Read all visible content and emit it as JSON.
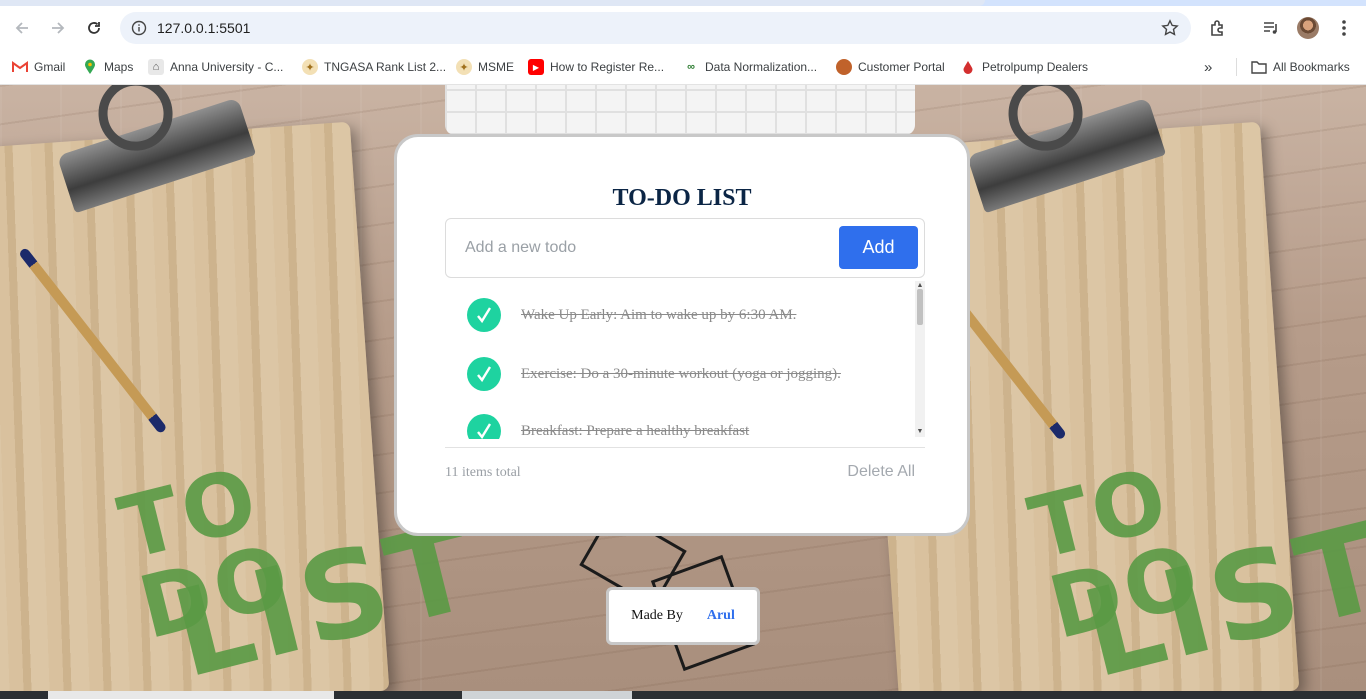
{
  "browser": {
    "url": "127.0.0.1:5501",
    "bookmarks": [
      {
        "label": "Gmail",
        "icon": "gmail-icon",
        "color": "#ea4335"
      },
      {
        "label": "Maps",
        "icon": "maps-pin-icon",
        "color": "#34a853"
      },
      {
        "label": "Anna University - C...",
        "icon": "university-icon",
        "color": "#5f6368"
      },
      {
        "label": "TNGASA Rank List 2...",
        "icon": "emblem-icon",
        "color": "#c28a2b"
      },
      {
        "label": "MSME",
        "icon": "emblem-icon",
        "color": "#c28a2b"
      },
      {
        "label": "How to Register Re...",
        "icon": "youtube-icon",
        "color": "#ff0000"
      },
      {
        "label": "Data Normalization...",
        "icon": "link-icon",
        "color": "#2e7d32"
      },
      {
        "label": "Customer Portal",
        "icon": "portal-icon",
        "color": "#c0622b"
      },
      {
        "label": "Petrolpump Dealers",
        "icon": "drop-icon",
        "color": "#d32f2f"
      }
    ],
    "all_bookmarks": "All Bookmarks",
    "more": "»"
  },
  "app": {
    "title": "TO-DO LIST",
    "input_placeholder": "Add a new todo",
    "add_label": "Add",
    "todos": [
      {
        "text": "Wake Up Early: Aim to wake up by 6:30 AM.",
        "done": true
      },
      {
        "text": "Exercise: Do a 30-minute workout (yoga or jogging).",
        "done": true
      },
      {
        "text": "Breakfast: Prepare a healthy breakfast",
        "done": true
      }
    ],
    "items_total": "11 items total",
    "delete_all": "Delete All",
    "made_by_label": "Made By",
    "made_by_author": "Arul"
  },
  "background": {
    "clipboard_text_line1": "TO DO",
    "clipboard_text_line2": "LIST"
  }
}
